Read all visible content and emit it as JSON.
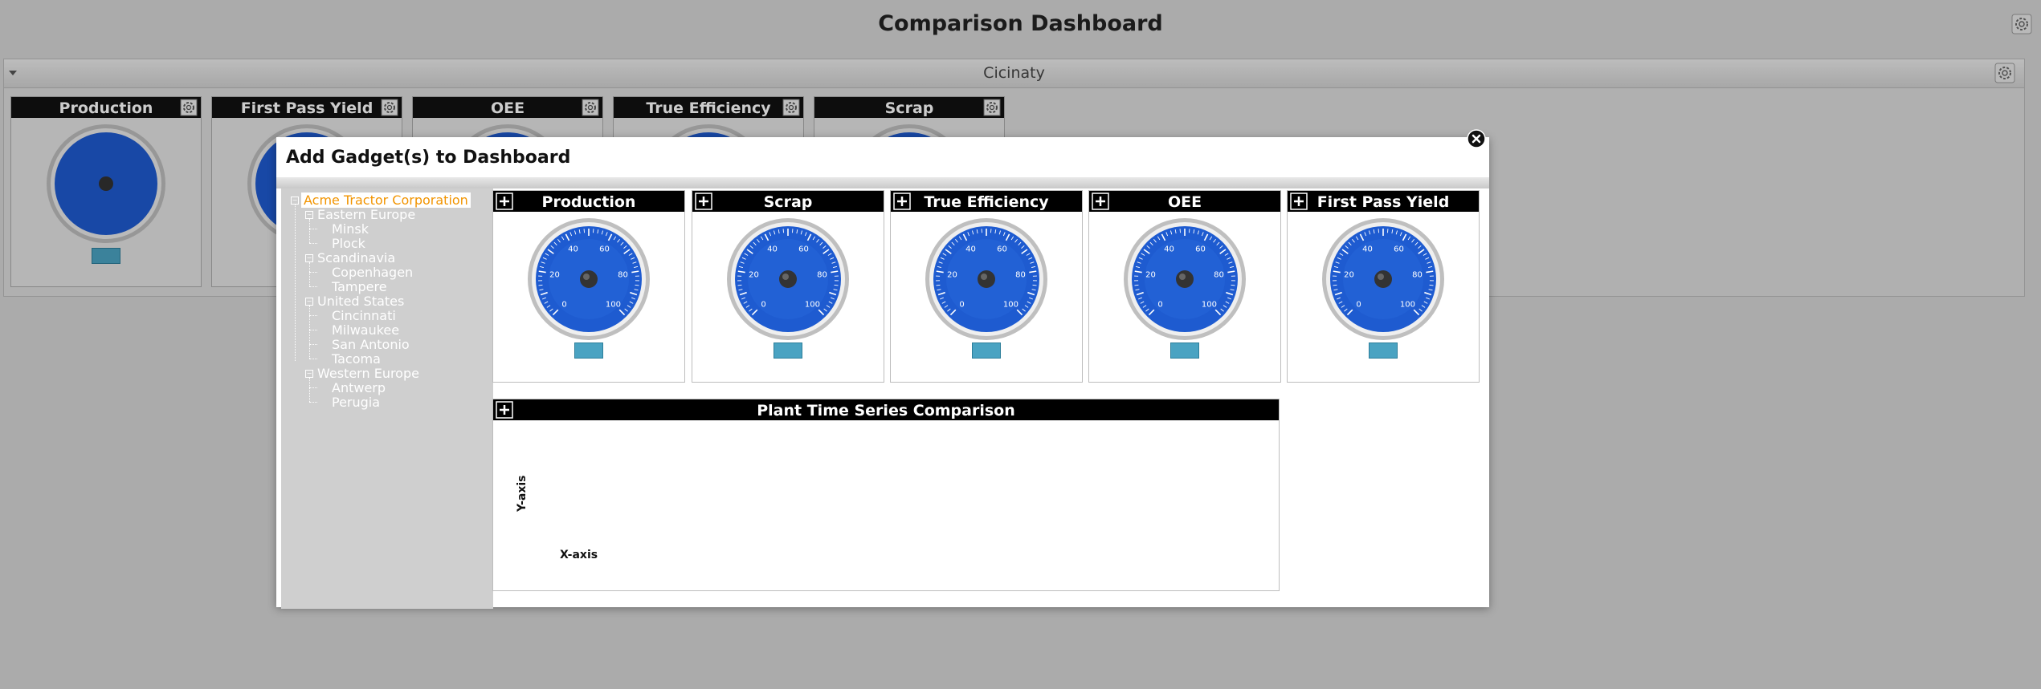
{
  "page": {
    "title": "Comparison Dashboard"
  },
  "region": {
    "title": "Cicinaty"
  },
  "background_gadgets": [
    {
      "title": "Production"
    },
    {
      "title": "First Pass Yield"
    },
    {
      "title": "OEE"
    },
    {
      "title": "True Efficiency"
    },
    {
      "title": "Scrap"
    }
  ],
  "modal": {
    "title": "Add Gadget(s) to Dashboard",
    "tree": {
      "root": "Acme Tractor Corporation",
      "groups": [
        {
          "label": "Eastern Europe",
          "children": [
            "Minsk",
            "Plock"
          ]
        },
        {
          "label": "Scandinavia",
          "children": [
            "Copenhagen",
            "Tampere"
          ]
        },
        {
          "label": "United States",
          "children": [
            "Cincinnati",
            "Milwaukee",
            "San Antonio",
            "Tacoma"
          ]
        },
        {
          "label": "Western Europe",
          "children": [
            "Antwerp",
            "Perugia"
          ]
        }
      ]
    },
    "gadgets": [
      {
        "title": "Production"
      },
      {
        "title": "Scrap"
      },
      {
        "title": "True Efficiency"
      },
      {
        "title": "OEE"
      },
      {
        "title": "First Pass Yield"
      }
    ],
    "time_series": {
      "title": "Plant Time Series Comparison",
      "ylabel": "Y-axis",
      "xlabel": "X-axis"
    }
  },
  "gauge": {
    "ticks": [
      "0",
      "20",
      "40",
      "60",
      "80",
      "100"
    ],
    "face_color": "#1e5bd0",
    "rim_color": "#bfbfbf",
    "needle_hub": "#333333"
  },
  "icons": {
    "settings": "gear-icon",
    "add": "plus-box-icon",
    "close": "close-icon",
    "collapse": "triangle-down-icon"
  }
}
